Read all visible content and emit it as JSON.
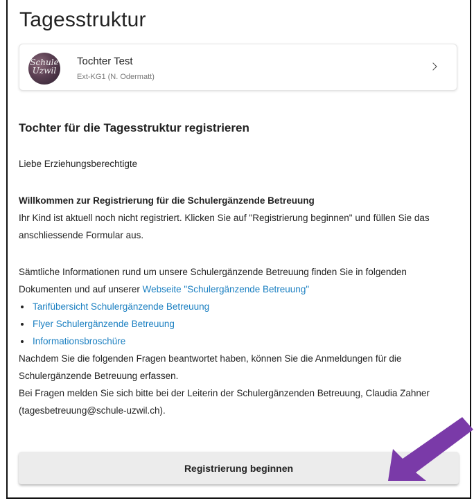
{
  "app": {
    "title": "Tagesstruktur"
  },
  "child_card": {
    "avatar_text_line1": "Schule",
    "avatar_text_line2": "Uzwil",
    "name": "Tochter Test",
    "class": "Ext-KG1 (N. Odermatt)",
    "icon": "chevron-right-icon"
  },
  "section": {
    "title": "Tochter für die Tagesstruktur registrieren"
  },
  "content": {
    "greeting": "Liebe Erziehungsberechtigte",
    "welcome_heading": "Willkommen zur Registrierung für die Schulergänzende Betreuung",
    "intro": "Ihr Kind ist aktuell noch nicht registriert. Klicken Sie auf \"Registrierung beginnen\" und füllen Sie das anschliessende Formular aus.",
    "info_text": "Sämtliche Informationen rund um unsere Schulergänzende Betreuung finden Sie in folgenden Dokumenten und auf unserer ",
    "website_link": "Webseite \"Schulergänzende Betreuung\"",
    "links": [
      "Tarifübersicht Schulergänzende Betreuung",
      "Flyer Schulergänzende Betreuung",
      "Informationsbroschüre"
    ],
    "after_questions": "Nachdem Sie die folgenden Fragen beantwortet haben, können Sie die Anmeldungen für die Schulergänzende Betreuung erfassen.",
    "contact": "Bei Fragen melden Sie sich bitte bei der Leiterin der Schulergänzenden Betreuung, Claudia Zahner (tagesbetreuung@schule-uzwil.ch)."
  },
  "register_button": {
    "label": "Registrierung beginnen"
  },
  "annotation": {
    "arrow_color": "#7a3aa8"
  }
}
